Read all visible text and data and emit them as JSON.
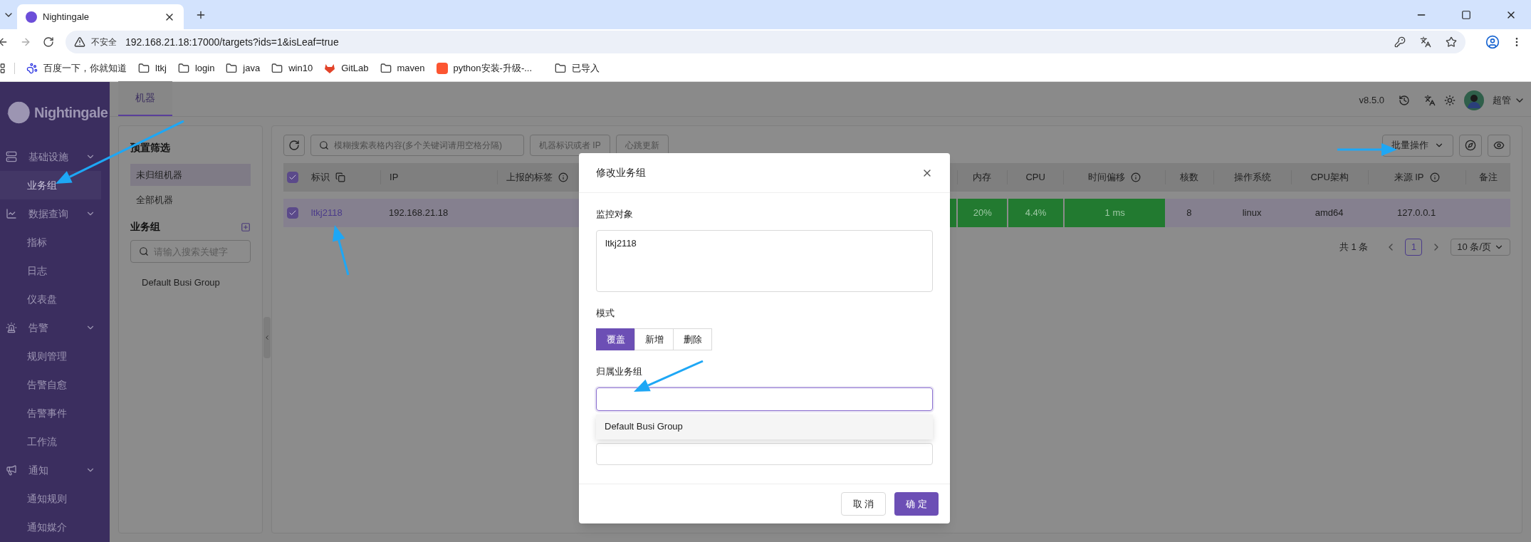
{
  "browser": {
    "tab_title": "Nightingale",
    "security": "不安全",
    "url": "192.168.21.18:17000/targets?ids=1&isLeaf=true",
    "bookmarks": [
      {
        "kind": "baidu",
        "label": "百度一下，你就知道"
      },
      {
        "kind": "folder",
        "label": "ltkj"
      },
      {
        "kind": "folder",
        "label": "login"
      },
      {
        "kind": "folder",
        "label": "java"
      },
      {
        "kind": "folder",
        "label": "win10"
      },
      {
        "kind": "gitlab",
        "label": "GitLab"
      },
      {
        "kind": "folder",
        "label": "maven"
      },
      {
        "kind": "csdn",
        "label": "python安装-升级-..."
      },
      {
        "kind": "folder",
        "label": "已导入"
      }
    ]
  },
  "logo": "Nightingale",
  "sidebar": [
    {
      "kind": "server",
      "label": "基础设施",
      "expanded": true,
      "children": [
        {
          "label": "业务组",
          "selected": true
        }
      ]
    },
    {
      "kind": "chart",
      "label": "数据查询",
      "expanded": true,
      "children": [
        {
          "label": "指标",
          "selected": false
        },
        {
          "label": "日志",
          "selected": false
        },
        {
          "label": "仪表盘",
          "selected": false
        }
      ]
    },
    {
      "kind": "alarm",
      "label": "告警",
      "expanded": true,
      "children": [
        {
          "label": "规则管理",
          "selected": false
        },
        {
          "label": "告警自愈",
          "selected": false
        },
        {
          "label": "告警事件",
          "selected": false
        },
        {
          "label": "工作流",
          "selected": false
        }
      ]
    },
    {
      "kind": "megaphone",
      "label": "通知",
      "expanded": true,
      "children": [
        {
          "label": "通知规则",
          "selected": false
        },
        {
          "label": "通知媒介",
          "selected": false
        }
      ]
    }
  ],
  "header": {
    "tabs": [
      {
        "label": "机器",
        "selected": true
      }
    ],
    "version": "v8.5.0",
    "user": "超管"
  },
  "filter_panel": {
    "title": "预置筛选",
    "presets": [
      {
        "label": "未归组机器",
        "selected": true
      },
      {
        "label": "全部机器",
        "selected": false
      }
    ],
    "groups_title": "业务组",
    "search_placeholder": "请输入搜索关键字",
    "groups": [
      {
        "label": "Default Busi Group",
        "selected": false
      }
    ]
  },
  "toolbar": {
    "search_placeholder": "模糊搜索表格内容(多个关键词请用空格分隔)",
    "filters": [
      "机器标识或者 IP",
      "心跳更新"
    ],
    "batch_button": "批量操作"
  },
  "table": {
    "columns": [
      {
        "kind": "text",
        "label": "标识",
        "copyable": true
      },
      {
        "kind": "text",
        "label": "IP"
      },
      {
        "kind": "text",
        "label": "上报的标签",
        "hint": true
      },
      {
        "kind": "covered"
      },
      {
        "kind": "text",
        "label": "内存"
      },
      {
        "kind": "text",
        "label": "CPU"
      },
      {
        "kind": "text",
        "label": "时间偏移",
        "hint": true
      },
      {
        "kind": "text",
        "label": "核数"
      },
      {
        "kind": "text",
        "label": "操作系统"
      },
      {
        "kind": "text",
        "label": "CPU架构"
      },
      {
        "kind": "text",
        "label": "来源 IP",
        "hint": true
      },
      {
        "kind": "text",
        "label": "备注"
      }
    ],
    "all_checked": true,
    "rows": [
      {
        "checked": true,
        "selected": true,
        "cells": [
          {
            "kind": "link",
            "text": "ltkj2118"
          },
          {
            "kind": "text",
            "text": "192.168.21.18"
          },
          {
            "kind": "empty"
          },
          {
            "kind": "covered",
            "color": "#227a30"
          },
          {
            "kind": "text",
            "text": "20%",
            "color": "#227a30"
          },
          {
            "kind": "text",
            "text": "4.4%",
            "color": "#227a30"
          },
          {
            "kind": "text",
            "text": "1 ms",
            "color": "#227a30"
          },
          {
            "kind": "text",
            "text": "8"
          },
          {
            "kind": "text",
            "text": "linux"
          },
          {
            "kind": "text",
            "text": "amd64"
          },
          {
            "kind": "text",
            "text": "127.0.0.1"
          },
          {
            "kind": "empty"
          }
        ]
      }
    ]
  },
  "pagination": {
    "total": "共 1 条",
    "pages": [
      {
        "label": "1",
        "selected": true
      }
    ],
    "page_size": "10 条/页"
  },
  "modal": {
    "title": "修改业务组",
    "target_label": "监控对象",
    "target_value": "ltkj2118",
    "mode_label": "模式",
    "modes": [
      {
        "label": "覆盖",
        "selected": true
      },
      {
        "label": "新增",
        "selected": false
      },
      {
        "label": "删除",
        "selected": false
      }
    ],
    "group_label": "归属业务组",
    "options": [
      {
        "label": "Default Busi Group",
        "selected": false
      }
    ],
    "cancel": "取 消",
    "ok": "确 定"
  }
}
